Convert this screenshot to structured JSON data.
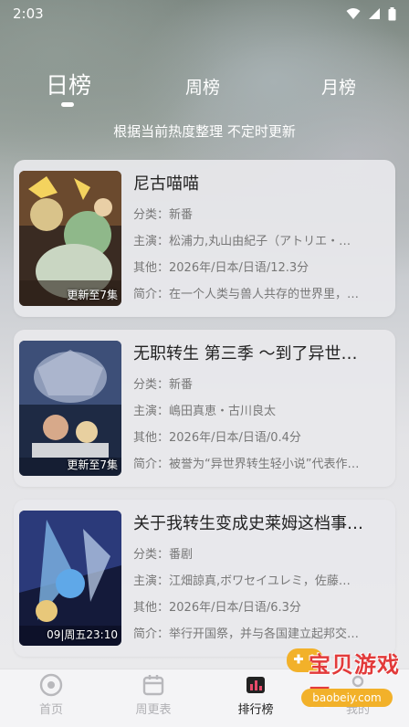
{
  "status_bar": {
    "time": "2:03"
  },
  "tabs": {
    "daily": "日榜",
    "weekly": "周榜",
    "monthly": "月榜"
  },
  "subtitle": "根据当前热度整理 不定时更新",
  "cards": [
    {
      "title": "尼古喵喵",
      "category": "分类：新番",
      "cast": "主演：松浦力,丸山由紀子（アトリエ・…",
      "other": "其他：2026年/日本/日语/12.3分",
      "summary": "简介：在一个人类与兽人共存的世界里，…",
      "badge": "更新至7集"
    },
    {
      "title": "无职转生 第三季 ～到了异世…",
      "category": "分类：新番",
      "cast": "主演：嶋田真恵・古川良太",
      "other": "其他：2026年/日本/日语/0.4分",
      "summary": "简介：被誉为“异世界转生轻小说”代表作…",
      "badge": "更新至7集"
    },
    {
      "title": "关于我转生变成史莱姆这档事…",
      "category": "分类：番剧",
      "cast": "主演：江畑諒真,ボワセイユレミ，佐藤…",
      "other": "其他：2026年/日本/日语/6.3分",
      "summary": "简介：举行开国祭，并与各国建立起邦交…",
      "badge": "09|周五23:10"
    }
  ],
  "bottom_nav": {
    "home": "首页",
    "schedule": "周更表",
    "rank": "排行榜",
    "mine": "我的"
  },
  "watermark": {
    "title": "宝贝游戏网",
    "url": "baobeiy.com"
  }
}
